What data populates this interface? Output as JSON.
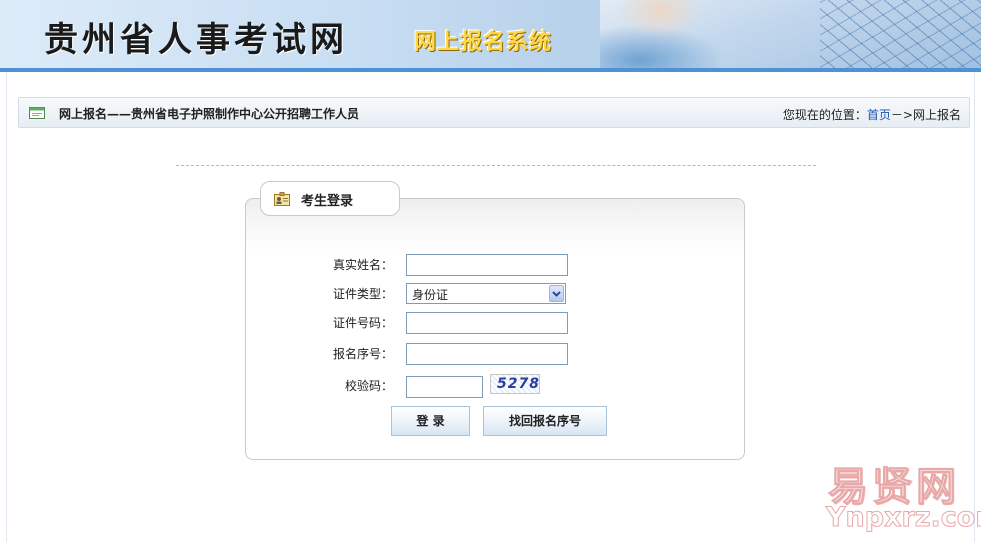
{
  "header": {
    "title": "贵州省人事考试网",
    "subtitle": "网上报名系统"
  },
  "breadcrumb_bar": {
    "page_title": "网上报名——贵州省电子护照制作中心公开招聘工作人员",
    "location_prefix": "您现在的位置：",
    "home_link": "首页",
    "separator": "－>",
    "current": "网上报名"
  },
  "login_panel": {
    "tab_label": "考生登录",
    "fields": {
      "name_label": "真实姓名：",
      "name_value": "",
      "id_type_label": "证件类型：",
      "id_type_selected": "身份证",
      "id_number_label": "证件号码：",
      "id_number_value": "",
      "reg_number_label": "报名序号：",
      "reg_number_value": "",
      "captcha_label": "校验码：",
      "captcha_value": "",
      "captcha_image_text": "5278"
    },
    "buttons": {
      "login": "登  录",
      "retrieve": "找回报名序号"
    }
  },
  "watermark": {
    "cn": "易贤网",
    "en": "Ynpxrz.com"
  },
  "colors": {
    "link": "#1a56b4",
    "banner_stripe": "#4f91d6",
    "subtitle_gold": "#ffd84a",
    "panel_border": "#c9c9c9",
    "button_border": "#a9c3dc"
  },
  "icons": {
    "breadcrumb": "window-icon",
    "tab": "user-card-icon",
    "select_arrow": "chevron-down-icon"
  }
}
